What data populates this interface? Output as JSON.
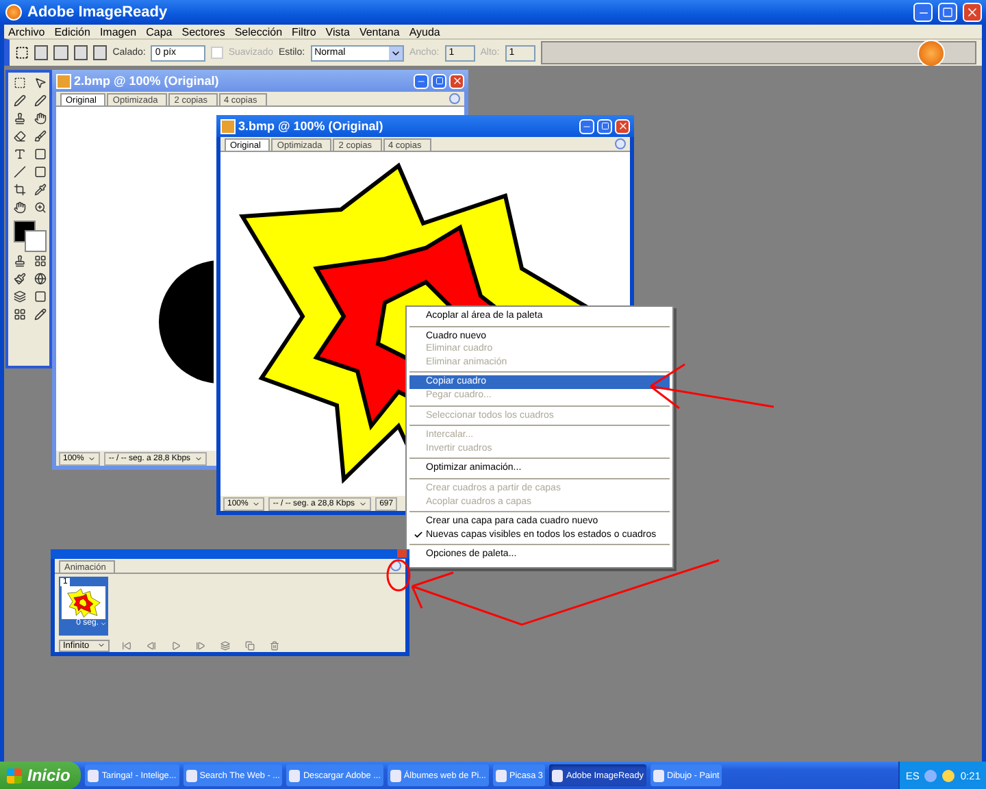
{
  "app": {
    "title": "Adobe ImageReady"
  },
  "menubar": [
    "Archivo",
    "Edición",
    "Imagen",
    "Capa",
    "Sectores",
    "Selección",
    "Filtro",
    "Vista",
    "Ventana",
    "Ayuda"
  ],
  "options_bar": {
    "feather_label": "Calado:",
    "feather_value": "0 píx",
    "antialias": {
      "label": "Suavizado",
      "checked": false,
      "disabled": true
    },
    "style_label": "Estilo:",
    "style_value": "Normal",
    "width_label": "Ancho:",
    "width_value": "1",
    "height_label": "Alto:",
    "height_value": "1"
  },
  "windows": [
    {
      "title": "2.bmp @ 100% (Original)",
      "active": false,
      "tabs": [
        {
          "label": "Original",
          "selected": true
        },
        {
          "label": "Optimizada",
          "selected": false
        },
        {
          "label": "2 copias",
          "selected": false
        },
        {
          "label": "4 copias",
          "selected": false
        }
      ],
      "status": {
        "zoom": "100%",
        "speed": "-- / -- seg. a 28,8 Kbps"
      }
    },
    {
      "title": "3.bmp @ 100% (Original)",
      "active": true,
      "tabs": [
        {
          "label": "Original",
          "selected": true
        },
        {
          "label": "Optimizada",
          "selected": false
        },
        {
          "label": "2 copias",
          "selected": false
        },
        {
          "label": "4 copias",
          "selected": false
        }
      ],
      "status": {
        "zoom": "100%",
        "speed": "-- / -- seg. a 28,8 Kbps",
        "size": "697"
      }
    }
  ],
  "context_menu": [
    {
      "kind": "item",
      "label": "Acoplar al área de la paleta",
      "disabled": false,
      "selected": false,
      "checked": false
    },
    {
      "kind": "separator"
    },
    {
      "kind": "item",
      "label": "Cuadro nuevo",
      "disabled": false,
      "selected": false,
      "checked": false
    },
    {
      "kind": "item",
      "label": "Eliminar cuadro",
      "disabled": true,
      "selected": false,
      "checked": false
    },
    {
      "kind": "item",
      "label": "Eliminar animación",
      "disabled": true,
      "selected": false,
      "checked": false
    },
    {
      "kind": "separator"
    },
    {
      "kind": "item",
      "label": "Copiar cuadro",
      "disabled": false,
      "selected": true,
      "checked": false
    },
    {
      "kind": "item",
      "label": "Pegar cuadro...",
      "disabled": true,
      "selected": false,
      "checked": false
    },
    {
      "kind": "separator"
    },
    {
      "kind": "item",
      "label": "Seleccionar todos los cuadros",
      "disabled": true,
      "selected": false,
      "checked": false
    },
    {
      "kind": "separator"
    },
    {
      "kind": "item",
      "label": "Intercalar...",
      "disabled": true,
      "selected": false,
      "checked": false
    },
    {
      "kind": "item",
      "label": "Invertir cuadros",
      "disabled": true,
      "selected": false,
      "checked": false
    },
    {
      "kind": "separator"
    },
    {
      "kind": "item",
      "label": "Optimizar animación...",
      "disabled": false,
      "selected": false,
      "checked": false
    },
    {
      "kind": "separator"
    },
    {
      "kind": "item",
      "label": "Crear cuadros a partir de capas",
      "disabled": true,
      "selected": false,
      "checked": false
    },
    {
      "kind": "item",
      "label": "Acoplar cuadros a capas",
      "disabled": true,
      "selected": false,
      "checked": false
    },
    {
      "kind": "separator"
    },
    {
      "kind": "item",
      "label": "Crear una capa para cada cuadro nuevo",
      "disabled": false,
      "selected": false,
      "checked": false
    },
    {
      "kind": "item",
      "label": "Nuevas capas visibles en todos los estados o cuadros",
      "disabled": false,
      "selected": false,
      "checked": true
    },
    {
      "kind": "separator"
    },
    {
      "kind": "item",
      "label": "Opciones de paleta...",
      "disabled": false,
      "selected": false,
      "checked": false
    }
  ],
  "animation_palette": {
    "tab": "Animación",
    "frames": [
      {
        "number": "1",
        "delay": "0 seg.",
        "selected": true
      }
    ],
    "loop": "Infinito"
  },
  "taskbar": {
    "start": "Inicio",
    "tasks": [
      {
        "label": "Taringa! - Intelige...",
        "selected": false
      },
      {
        "label": "Search The Web - ...",
        "selected": false
      },
      {
        "label": "Descargar Adobe ...",
        "selected": false
      },
      {
        "label": "Álbumes web de Pi...",
        "selected": false
      },
      {
        "label": "Picasa 3",
        "selected": false
      },
      {
        "label": "Adobe ImageReady",
        "selected": true
      },
      {
        "label": "Dibujo - Paint",
        "selected": false
      }
    ],
    "language": "ES",
    "clock": "0:21"
  }
}
